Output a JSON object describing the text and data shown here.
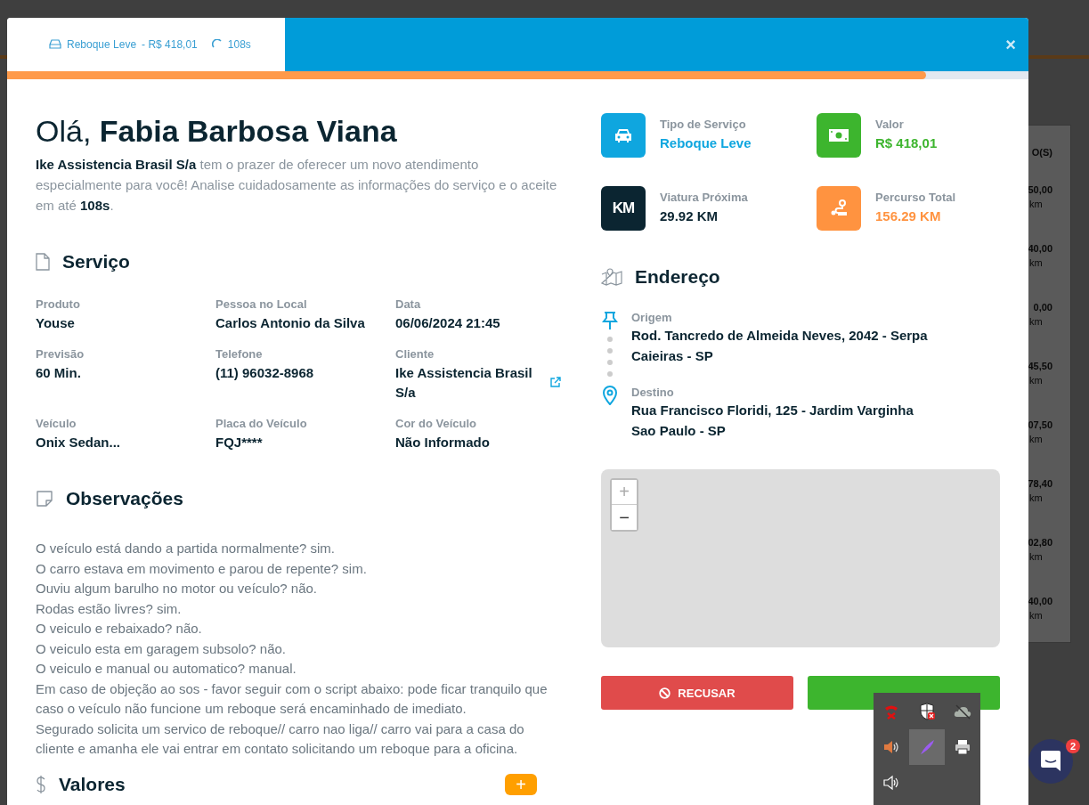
{
  "background": {
    "column_heading": "O(S)",
    "rows": [
      {
        "value": "50,00",
        "unit": "km"
      },
      {
        "value": "40,00",
        "unit": "km"
      },
      {
        "value": "0,00",
        "unit": "km"
      },
      {
        "value": "45,50",
        "unit": "km"
      },
      {
        "value": "07,50",
        "unit": "km"
      },
      {
        "value": "78,40",
        "unit": "km"
      },
      {
        "value": "02,80",
        "unit": "km"
      },
      {
        "value": "40,00",
        "unit": "km"
      }
    ]
  },
  "modal": {
    "header": {
      "service": "Reboque Leve",
      "price": "- R$ 418,01",
      "timer": "108s",
      "close": "×"
    },
    "progress": {
      "level": 0.9
    },
    "greeting": {
      "prefix": "Olá,",
      "name": "Fabia Barbosa Viana"
    },
    "intro": "**Ike Assistencia Brasil S/a** tem o prazer de oferecer um novo atendimento especialmente para você! Analise cuidadosamente as informações do serviço e o aceite em até **108s**.",
    "service_section": {
      "title": "Serviço",
      "fields": [
        {
          "label": "Produto",
          "value": "Youse",
          "external_link": false
        },
        {
          "label": "Pessoa no Local",
          "value": "Carlos Antonio da Silva",
          "external_link": false
        },
        {
          "label": "Data",
          "value": "06/06/2024 21:45",
          "external_link": false
        },
        {
          "label": "Previsão",
          "value": "60 Min.",
          "external_link": false
        },
        {
          "label": "Telefone",
          "value": "(11) 96032-8968",
          "external_link": false
        },
        {
          "label": "Cliente",
          "value": "Ike Assistencia Brasil S/a",
          "external_link": true
        },
        {
          "label": "Veículo",
          "value": "Onix Sedan...",
          "external_link": false
        },
        {
          "label": "Placa do Veículo",
          "value": "FQJ****",
          "external_link": false
        },
        {
          "label": "Cor do Veículo",
          "value": "Não Informado",
          "external_link": false
        }
      ]
    },
    "observations": {
      "title": "Observações",
      "lines": [
        "O veículo está dando a partida normalmente? sim.",
        "O carro estava em movimento e parou de repente? sim.",
        "Ouviu algum barulho no motor ou veículo? não.",
        "Rodas estão livres? sim.",
        "O veiculo e rebaixado? não.",
        "O veiculo esta em garagem subsolo? não.",
        "O veiculo e manual ou automatico? manual.",
        "Em caso de objeção ao sos - favor seguir com o script abaixo: pode ficar tranquilo que caso o veículo não funcione um reboque será encaminhado de imediato.",
        "Segurado solicita um servico de reboque// carro nao liga// carro vai para a casa do cliente e amanha ele vai entrar em contato solicitando um reboque para a oficina."
      ]
    },
    "values_section": {
      "title": "Valores",
      "add": "+"
    },
    "stats": [
      {
        "kind": "car",
        "label": "Tipo de Serviço",
        "value": "Reboque Leve",
        "color": "#0fa6df"
      },
      {
        "kind": "money",
        "label": "Valor",
        "value": "R$ 418,01",
        "color": "#3db52e"
      },
      {
        "kind": "km",
        "label": "Viatura Próxima",
        "value": "29.92 KM",
        "color": "#0b2531",
        "icon_text": "KM"
      },
      {
        "kind": "route",
        "label": "Percurso Total",
        "value": "156.29 KM",
        "color": "#ff9340"
      }
    ],
    "address": {
      "title": "Endereço",
      "stops": [
        {
          "kind": "origin",
          "label": "Origem",
          "lines": [
            "Rod. Tancredo de Almeida Neves, 2042 - Serpa",
            "Caieiras - SP"
          ]
        },
        {
          "kind": "destination",
          "label": "Destino",
          "lines": [
            "Rua Francisco Floridi, 125 - Jardim Varginha",
            "Sao Paulo - SP"
          ]
        }
      ]
    },
    "map": {
      "zoom_in": "+",
      "zoom_out": "−"
    },
    "buttons": {
      "refuse": "RECUSAR"
    }
  },
  "chat": {
    "badge": "2"
  },
  "tray": {
    "icons": [
      {
        "kind": "phone",
        "selected": false
      },
      {
        "kind": "shield",
        "selected": false
      },
      {
        "kind": "cloud",
        "selected": false
      },
      {
        "kind": "speaker",
        "selected": false
      },
      {
        "kind": "feather",
        "selected": true
      },
      {
        "kind": "printer",
        "selected": false
      },
      {
        "kind": "speaker-outline",
        "selected": false
      }
    ]
  }
}
